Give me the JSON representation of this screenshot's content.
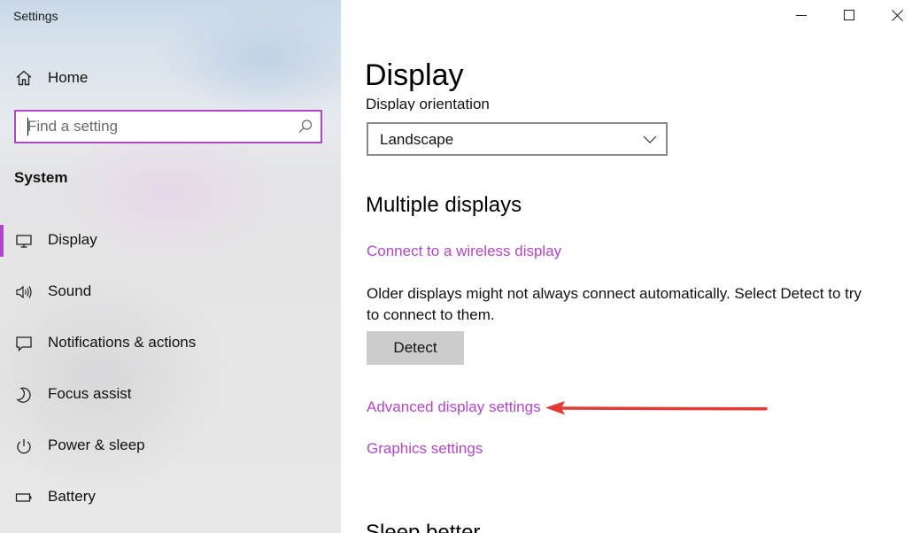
{
  "window": {
    "title": "Settings",
    "controls": {
      "minimize": "minimize",
      "maximize": "maximize",
      "close": "close"
    }
  },
  "sidebar": {
    "home_label": "Home",
    "search": {
      "placeholder": "Find a setting",
      "value": ""
    },
    "section_header": "System",
    "items": [
      {
        "label": "Display",
        "icon": "monitor-icon",
        "selected": true
      },
      {
        "label": "Sound",
        "icon": "speaker-icon",
        "selected": false
      },
      {
        "label": "Notifications & actions",
        "icon": "notification-icon",
        "selected": false
      },
      {
        "label": "Focus assist",
        "icon": "moon-icon",
        "selected": false
      },
      {
        "label": "Power & sleep",
        "icon": "power-icon",
        "selected": false
      },
      {
        "label": "Battery",
        "icon": "battery-icon",
        "selected": false
      }
    ]
  },
  "main": {
    "page_title": "Display",
    "orientation": {
      "label": "Display orientation",
      "selected": "Landscape"
    },
    "multiple_displays": {
      "title": "Multiple displays",
      "wireless_link": "Connect to a wireless display",
      "description": "Older displays might not always connect automatically. Select Detect to try to connect to them.",
      "detect_button": "Detect",
      "advanced_link": "Advanced display settings",
      "graphics_link": "Graphics settings"
    },
    "next_section_title": "Sleep better"
  },
  "colors": {
    "accent": "#b147c7",
    "annotation_arrow": "#e53935",
    "button_bg": "#cccccc"
  }
}
